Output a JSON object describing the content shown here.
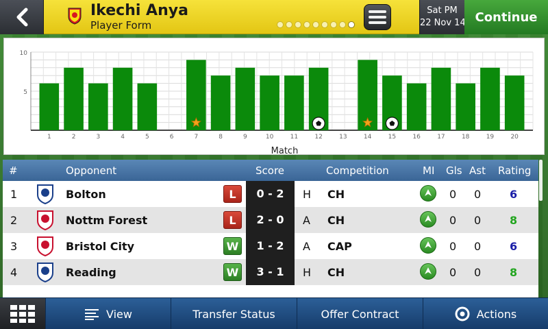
{
  "header": {
    "player_name": "Ikechi Anya",
    "screen_title": "Player Form",
    "page_dots": 9,
    "active_page_dot": 9,
    "date_day": "Sat PM",
    "date_date": "22 Nov 14",
    "continue_label": "Continue",
    "accent_color": "#f2d827",
    "continue_color": "#2f8d2b"
  },
  "chart_data": {
    "type": "bar",
    "xlabel": "Match",
    "ylim": [
      0,
      10
    ],
    "yticks": [
      5,
      10
    ],
    "categories": [
      "1",
      "2",
      "3",
      "4",
      "5",
      "6",
      "7",
      "8",
      "9",
      "10",
      "11",
      "12",
      "13",
      "14",
      "15",
      "16",
      "17",
      "18",
      "19",
      "20"
    ],
    "values": [
      6,
      8,
      6,
      8,
      6,
      null,
      9,
      7,
      8,
      7,
      7,
      8,
      null,
      9,
      7,
      6,
      8,
      6,
      8,
      7
    ],
    "markers": [
      {
        "match": "7",
        "type": "star"
      },
      {
        "match": "12",
        "type": "ball"
      },
      {
        "match": "14",
        "type": "star"
      },
      {
        "match": "15",
        "type": "ball"
      }
    ],
    "bar_color": "#0b8a0b",
    "grid": true
  },
  "table": {
    "headers": {
      "num": "#",
      "opponent": "Opponent",
      "score": "Score",
      "competition": "Competition",
      "mi": "MI",
      "gls": "Gls",
      "ast": "Ast",
      "rating": "Rating"
    },
    "rows": [
      {
        "num": "1",
        "opponent": "Bolton",
        "result": "L",
        "score": "0 - 2",
        "venue": "H",
        "competition": "CH",
        "gls": "0",
        "ast": "0",
        "rating": "6",
        "rating_color": "#1b1fa8",
        "crest_color": "#1a3f8a"
      },
      {
        "num": "2",
        "opponent": "Nottm Forest",
        "result": "L",
        "score": "2 - 0",
        "venue": "A",
        "competition": "CH",
        "gls": "0",
        "ast": "0",
        "rating": "8",
        "rating_color": "#22a51f",
        "crest_color": "#c8102e"
      },
      {
        "num": "3",
        "opponent": "Bristol City",
        "result": "W",
        "score": "1 - 2",
        "venue": "A",
        "competition": "CAP",
        "gls": "0",
        "ast": "0",
        "rating": "6",
        "rating_color": "#1b1fa8",
        "crest_color": "#c8102e"
      },
      {
        "num": "4",
        "opponent": "Reading",
        "result": "W",
        "score": "3 - 1",
        "venue": "H",
        "competition": "CH",
        "gls": "0",
        "ast": "0",
        "rating": "8",
        "rating_color": "#22a51f",
        "crest_color": "#1a3f8a"
      }
    ]
  },
  "bottom_bar": {
    "view_label": "View",
    "transfer_label": "Transfer Status",
    "offer_label": "Offer Contract",
    "actions_label": "Actions"
  }
}
